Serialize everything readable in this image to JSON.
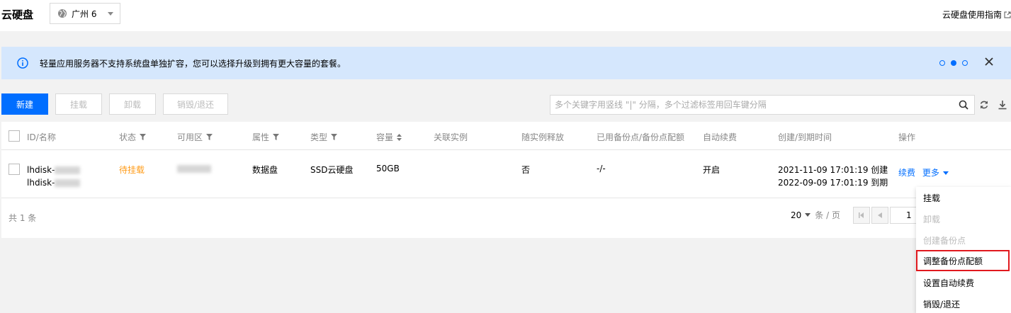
{
  "header": {
    "title": "云硬盘",
    "region": "广州 6",
    "guide_link": "云硬盘使用指南"
  },
  "notice": {
    "text": "轻量应用服务器不支持系统盘单独扩容，您可以选择升级到拥有更大容量的套餐。"
  },
  "toolbar": {
    "create": "新建",
    "mount": "挂载",
    "unmount": "卸载",
    "destroy": "销毁/退还",
    "search_placeholder": "多个关键字用竖线 \"|\" 分隔，多个过滤标签用回车键分隔"
  },
  "table": {
    "columns": {
      "id": "ID/名称",
      "status": "状态",
      "zone": "可用区",
      "attribute": "属性",
      "type": "类型",
      "capacity": "容量",
      "instance": "关联实例",
      "release": "随实例释放",
      "backup": "已用备份点/备份点配额",
      "auto_renew": "自动续费",
      "time": "创建/到期时间",
      "ops": "操作"
    },
    "rows": [
      {
        "id_prefix": "lhdisk-",
        "name_prefix": "lhdisk-",
        "status": "待挂载",
        "attribute": "数据盘",
        "type": "SSD云硬盘",
        "capacity": "50GB",
        "release": "否",
        "backup": "-/-",
        "auto_renew": "开启",
        "created": "2021-11-09 17:01:19 创建",
        "expires": "2022-09-09 17:01:19 到期",
        "op_renew": "续费",
        "op_more": "更多"
      }
    ]
  },
  "footer": {
    "total": "共 1 条",
    "page_size": "20",
    "page_size_unit": "条 / 页",
    "current_page": "1"
  },
  "dropdown": {
    "items": [
      {
        "label": "挂载"
      },
      {
        "label": "卸载"
      },
      {
        "label": "创建备份点"
      },
      {
        "label": "调整备份点配额"
      },
      {
        "label": "设置自动续费"
      },
      {
        "label": "销毁/退还"
      }
    ]
  },
  "colors": {
    "primary": "#006eff",
    "warning": "#ff9c19",
    "notice_bg": "#d5e7fd",
    "highlight": "#e1191e"
  }
}
